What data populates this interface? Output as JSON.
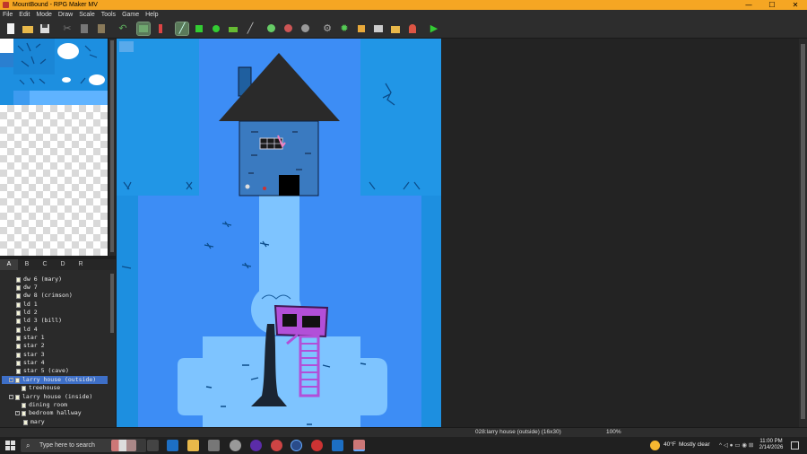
{
  "window": {
    "title": "MountBound - RPG Maker MV",
    "minimize": "—",
    "maximize": "☐",
    "close": "✕"
  },
  "menu": [
    "File",
    "Edit",
    "Mode",
    "Draw",
    "Scale",
    "Tools",
    "Game",
    "Help"
  ],
  "toolbar": {
    "buttons": [
      "new-project",
      "open-project",
      "save-project",
      "cut",
      "copy",
      "paste",
      "undo",
      "map-mode",
      "event-mode",
      "pencil",
      "rectangle",
      "ellipse",
      "flood-fill",
      "shadow-pen",
      "zoom-in",
      "zoom-out",
      "actual-size",
      "database",
      "plugin-manager",
      "sound-test",
      "event-searcher",
      "resource-manager",
      "character-generator",
      "playtest"
    ],
    "active": [
      "map-mode",
      "pencil"
    ]
  },
  "palette_tabs": [
    "A",
    "B",
    "C",
    "D",
    "R"
  ],
  "palette_active_tab": "A",
  "map_tree": [
    {
      "label": "dw 6 (mary)",
      "depth": 1
    },
    {
      "label": "dw 7",
      "depth": 1
    },
    {
      "label": "dw 8 (crimson)",
      "depth": 1
    },
    {
      "label": "ld 1",
      "depth": 1
    },
    {
      "label": "ld 2",
      "depth": 1
    },
    {
      "label": "ld 3 (bill)",
      "depth": 1
    },
    {
      "label": "ld 4",
      "depth": 1
    },
    {
      "label": "star 1",
      "depth": 1
    },
    {
      "label": "star 2",
      "depth": 1
    },
    {
      "label": "star 3",
      "depth": 1
    },
    {
      "label": "star 4",
      "depth": 1
    },
    {
      "label": "star 5 (cave)",
      "depth": 1
    },
    {
      "label": "larry house (outside)",
      "depth": 1,
      "selected": true,
      "expanded": true
    },
    {
      "label": "treehouse",
      "depth": 2
    },
    {
      "label": "larry house (inside)",
      "depth": 1,
      "expanded": true
    },
    {
      "label": "dining room",
      "depth": 2
    },
    {
      "label": "bedroom hallway",
      "depth": 2,
      "expanded": true
    },
    {
      "label": "mary",
      "depth": 3
    }
  ],
  "status": {
    "map_info": "028:larry house (outside) (16x30)",
    "zoom": "100%"
  },
  "taskbar": {
    "search_placeholder": "Type here to search",
    "weather_temp": "40°F",
    "weather_desc": "Mostly clear",
    "time": "11:00 PM",
    "date": "2/14/2026"
  },
  "colors": {
    "titlebar": "#f5a623",
    "map_water": "#1d8fe0",
    "map_ground": "#3d8df5",
    "map_path": "#7ec4ff",
    "tree_selection": "#3e6fc7"
  }
}
